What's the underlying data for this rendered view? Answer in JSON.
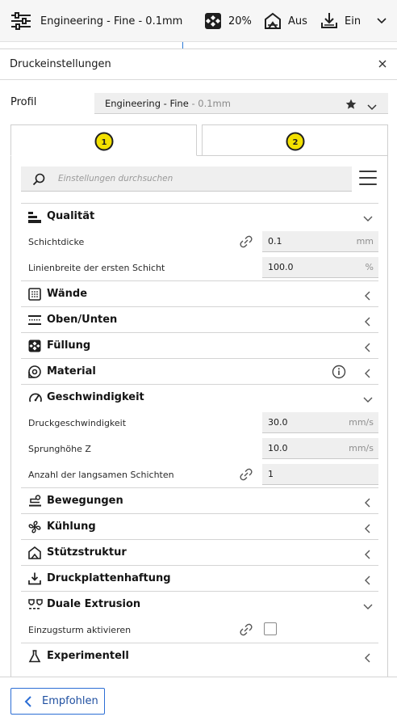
{
  "topbar": {
    "profile_label": "Engineering - Fine - 0.1mm",
    "infill_value": "20%",
    "support_value": "Aus",
    "adhesion_value": "Ein",
    "icons": [
      "sliders-icon",
      "infill-icon",
      "support-icon",
      "adhesion-icon",
      "chevron-down-icon"
    ]
  },
  "panel": {
    "title": "Druckeinstellungen",
    "close_icon": "close-icon",
    "profile": {
      "label": "Profil",
      "selected_name": "Engineering - Fine",
      "selected_sub": " - 0.1mm",
      "icons": [
        "star-icon",
        "chevron-down-icon"
      ]
    },
    "tabs": [
      {
        "label": "1"
      },
      {
        "label": "2"
      }
    ],
    "search": {
      "placeholder": "Einstellungen durchsuchen"
    },
    "categories": {
      "quality": "Qualität",
      "walls": "Wände",
      "topbottom": "Oben/Unten",
      "infill": "Füllung",
      "material": "Material",
      "speed": "Geschwindigkeit",
      "travel": "Bewegungen",
      "cooling": "Kühlung",
      "support": "Stützstruktur",
      "adhesion": "Druckplattenhaftung",
      "dual": "Duale Extrusion",
      "experimental": "Experimentell"
    },
    "settings": {
      "layer_height": {
        "label": "Schichtdicke",
        "value": "0.1",
        "unit": "mm"
      },
      "initial_line_width": {
        "label": "Linienbreite der ersten Schicht",
        "value": "100.0",
        "unit": "%"
      },
      "print_speed": {
        "label": "Druckgeschwindigkeit",
        "value": "30.0",
        "unit": "mm/s"
      },
      "z_hop": {
        "label": "Sprunghöhe Z",
        "value": "10.0",
        "unit": "mm/s"
      },
      "slow_layers": {
        "label": "Anzahl der langsamen Schichten",
        "value": "1",
        "unit": ""
      },
      "prime_tower": {
        "label": "Einzugsturm aktivieren",
        "checked": false
      }
    },
    "recommended_button": "Empfohlen"
  },
  "colors": {
    "accent": "#2c6ed5",
    "badge_yellow": "#f3e100",
    "text": "#1f1f1f"
  }
}
